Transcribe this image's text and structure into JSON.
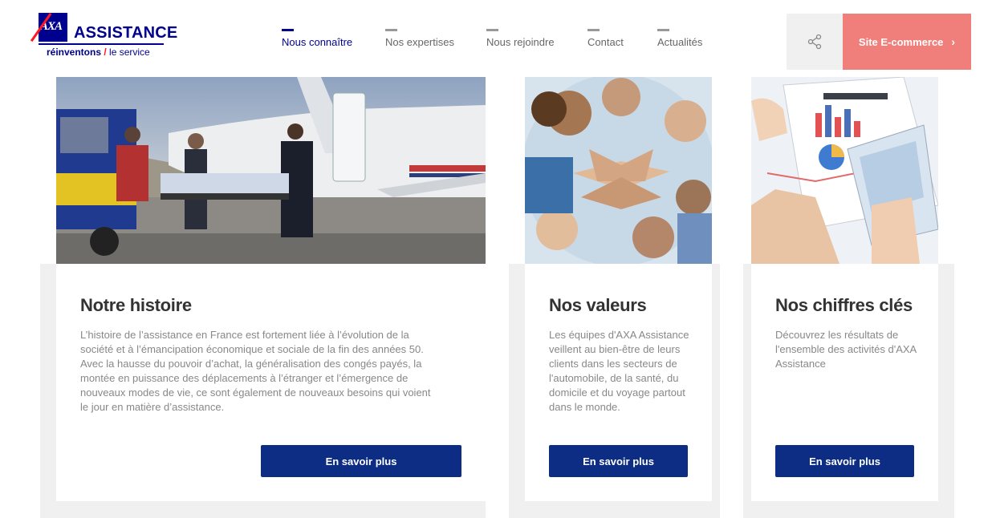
{
  "header": {
    "logo": {
      "brand": "ASSISTANCE",
      "axa": "AXA",
      "tagline_bold": "réinventons",
      "tagline_rest": "le service"
    },
    "nav": [
      {
        "label": "Nous connaître",
        "active": true
      },
      {
        "label": "Nos expertises",
        "active": false
      },
      {
        "label": "Nous rejoindre",
        "active": false
      },
      {
        "label": "Contact",
        "active": false
      },
      {
        "label": "Actualités",
        "active": false
      }
    ],
    "share_icon": "share-icon",
    "ecommerce_label": "Site E-commerce",
    "ecommerce_chevron": "›"
  },
  "cards": [
    {
      "image": "medical-evacuation-plane-photo",
      "title": "Notre histoire",
      "body": "L’histoire de l’assistance en France est fortement liée à l’évolution de la société et à l’émancipation économique et sociale de la fin des années 50. Avec la hausse du pouvoir d’achat, la généralisation des congés payés, la montée en puissance des déplacements à l’étranger et l’émergence de nouveaux modes de vie, ce sont également de nouveaux besoins qui voient le jour en matière d’assistance.",
      "button": "En savoir plus"
    },
    {
      "image": "team-hands-together-photo",
      "title": "Nos valeurs",
      "body": "Les équipes d'AXA Assistance veillent au bien-être de leurs clients dans les secteurs de l'automobile, de la santé, du domicile et du voyage partout dans le monde.",
      "button": "En savoir plus"
    },
    {
      "image": "charts-tablet-photo",
      "title": "Nos chiffres clés",
      "body": "Découvrez les résultats de l'ensemble des activités d'AXA Assistance",
      "button": "En savoir plus"
    }
  ],
  "colors": {
    "axa_blue": "#00008f",
    "axa_red": "#ff1721",
    "button_blue": "#0c2d83",
    "ecommerce_salmon": "#f07f7c"
  }
}
